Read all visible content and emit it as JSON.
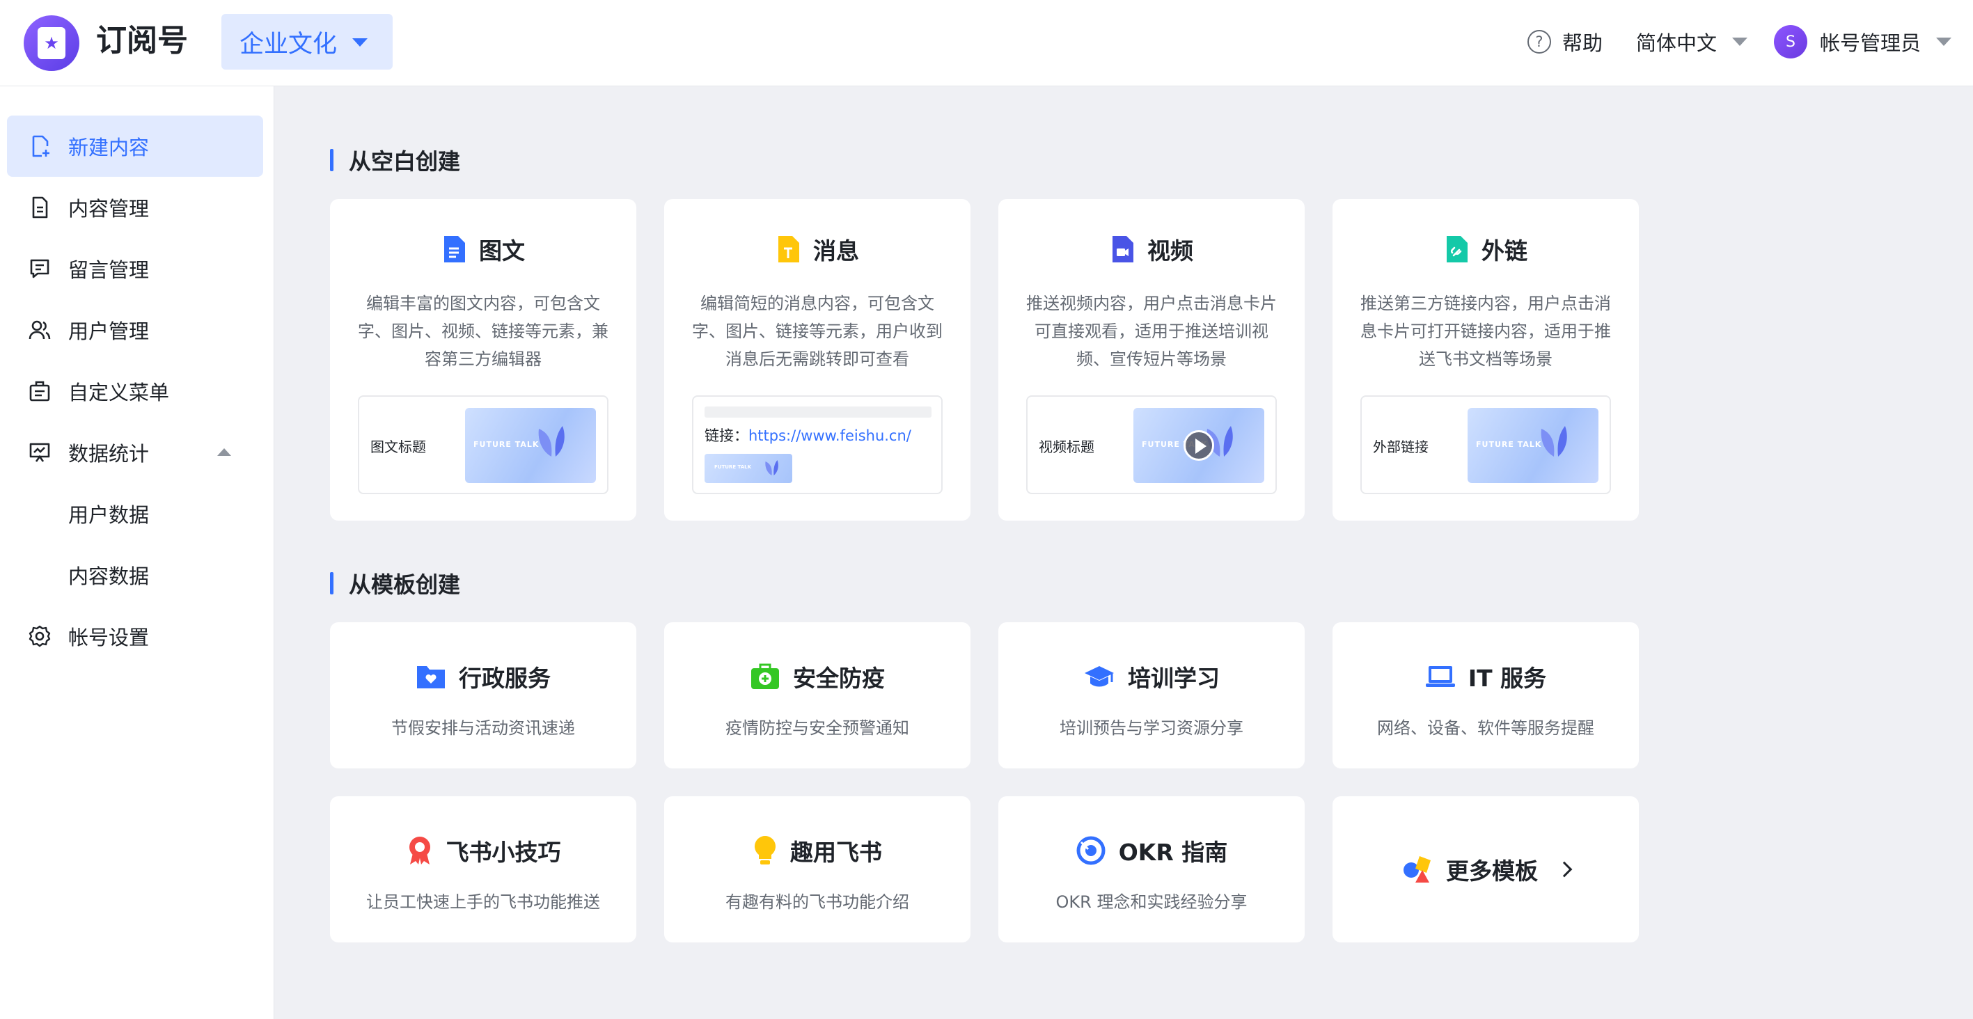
{
  "header": {
    "app_title": "订阅号",
    "workspace": "企业文化",
    "help": "帮助",
    "language": "简体中文",
    "user_initial": "S",
    "user_name": "帐号管理员"
  },
  "sidebar": {
    "items": [
      {
        "label": "新建内容",
        "icon": "new-doc-icon",
        "active": true
      },
      {
        "label": "内容管理",
        "icon": "document-icon"
      },
      {
        "label": "留言管理",
        "icon": "comment-icon"
      },
      {
        "label": "用户管理",
        "icon": "users-icon"
      },
      {
        "label": "自定义菜单",
        "icon": "menu-icon"
      },
      {
        "label": "数据统计",
        "icon": "chart-icon",
        "expanded": true
      },
      {
        "label": "用户数据",
        "sub": true
      },
      {
        "label": "内容数据",
        "sub": true
      },
      {
        "label": "帐号设置",
        "icon": "gear-icon"
      }
    ]
  },
  "blank": {
    "title": "从空白创建",
    "cards": [
      {
        "title": "图文",
        "icon": "article-icon",
        "desc": "编辑丰富的图文内容，可包含文字、图片、视频、链接等元素，兼容第三方编辑器",
        "preview_label": "图文标题",
        "thumb_text": "FUTURE TALK"
      },
      {
        "title": "消息",
        "icon": "message-icon",
        "desc": "编辑简短的消息内容，可包含文字、图片、链接等元素，用户收到消息后无需跳转即可查看",
        "link_label": "链接：",
        "link_url": "https://www.feishu.cn/",
        "thumb_text": "FUTURE TALK"
      },
      {
        "title": "视频",
        "icon": "video-icon",
        "desc": "推送视频内容，用户点击消息卡片可直接观看，适用于推送培训视频、宣传短片等场景",
        "preview_label": "视频标题",
        "thumb_text": "FUTURE TALK"
      },
      {
        "title": "外链",
        "icon": "link-icon",
        "desc": "推送第三方链接内容，用户点击消息卡片可打开链接内容，适用于推送飞书文档等场景",
        "preview_label": "外部链接",
        "thumb_text": "FUTURE TALK"
      }
    ]
  },
  "template": {
    "title": "从模板创建",
    "cards": [
      {
        "title": "行政服务",
        "icon": "folder-heart-icon",
        "desc": "节假安排与活动资讯速递"
      },
      {
        "title": "安全防疫",
        "icon": "medical-kit-icon",
        "desc": "疫情防控与安全预警通知"
      },
      {
        "title": "培训学习",
        "icon": "graduation-cap-icon",
        "desc": "培训预告与学习资源分享"
      },
      {
        "title": "IT 服务",
        "icon": "laptop-icon",
        "desc": "网络、设备、软件等服务提醒"
      },
      {
        "title": "飞书小技巧",
        "icon": "badge-icon",
        "desc": "让员工快速上手的飞书功能推送"
      },
      {
        "title": "趣用飞书",
        "icon": "lightbulb-icon",
        "desc": "有趣有料的飞书功能介绍"
      },
      {
        "title": "OKR 指南",
        "icon": "okr-icon",
        "desc": "OKR 理念和实践经验分享"
      }
    ],
    "more": "更多模板"
  }
}
